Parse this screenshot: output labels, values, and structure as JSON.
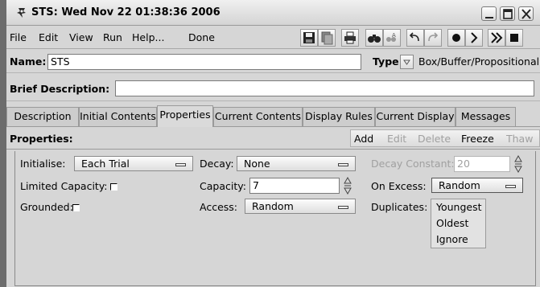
{
  "window": {
    "title": "STS: Wed Nov 22 01:38:36 2006"
  },
  "menu": {
    "items": [
      "File",
      "Edit",
      "View",
      "Run",
      "Help...",
      "Done"
    ]
  },
  "toolbar": {
    "icons": [
      "save-icon",
      "copy-icon",
      "print-icon",
      "find-icon",
      "replace-icon",
      "undo-icon",
      "redo-icon",
      "record-icon",
      "step-icon",
      "fast-forward-icon",
      "stop-icon"
    ]
  },
  "name_row": {
    "name_label": "Name:",
    "name_value": "STS",
    "type_label": "Type:",
    "type_value": "Box/Buffer/Propositional"
  },
  "desc_row": {
    "label": "Brief Description:",
    "value": ""
  },
  "tabs": [
    "Description",
    "Initial Contents",
    "Properties",
    "Current Contents",
    "Display Rules",
    "Current Display",
    "Messages"
  ],
  "active_tab": "Properties",
  "panel": {
    "title": "Properties:",
    "actions": [
      {
        "label": "Add",
        "enabled": true
      },
      {
        "label": "Edit",
        "enabled": false
      },
      {
        "label": "Delete",
        "enabled": false
      },
      {
        "label": "Freeze",
        "enabled": true
      },
      {
        "label": "Thaw",
        "enabled": false
      }
    ]
  },
  "properties": {
    "initialise_label": "Initialise:",
    "initialise_value": "Each Trial",
    "decay_label": "Decay:",
    "decay_value": "None",
    "decay_constant_label": "Decay Constant:",
    "decay_constant_value": "20",
    "limited_capacity_label": "Limited Capacity:",
    "limited_capacity_checked": false,
    "capacity_label": "Capacity:",
    "capacity_value": "7",
    "on_excess_label": "On Excess:",
    "on_excess_value": "Random",
    "grounded_label": "Grounded:",
    "grounded_checked": false,
    "access_label": "Access:",
    "access_value": "Random",
    "duplicates_label": "Duplicates:"
  },
  "on_excess_options": [
    "Youngest",
    "Oldest",
    "Ignore"
  ]
}
